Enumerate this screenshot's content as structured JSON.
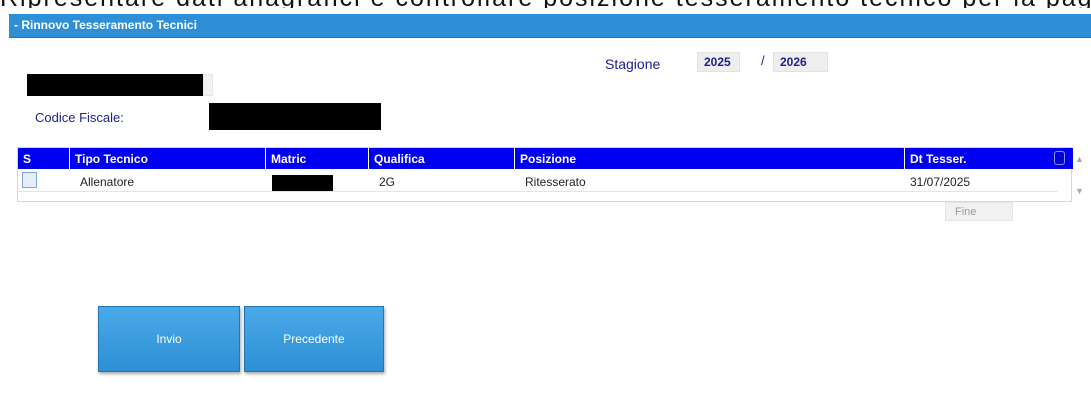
{
  "top_strip_text": "Ripresentare dati anagrafici e controllare posizione tesseramento tecnico per la pagina",
  "window": {
    "title": "- Rinnovo Tesseramento Tecnici"
  },
  "season": {
    "label": "Stagione",
    "from": "2025",
    "separator": "/",
    "to": "2026"
  },
  "person": {
    "codice_fiscale_label": "Codice Fiscale:"
  },
  "table": {
    "columns": [
      "S",
      "Tipo Tecnico",
      "Matric",
      "Qualifica",
      "Posizione",
      "Dt Tesser."
    ],
    "rows": [
      {
        "selected": false,
        "tipo_tecnico": "Allenatore",
        "matric": "",
        "qualifica": "2G",
        "posizione": "Ritesserato",
        "dt_tesser": "31/07/2025"
      }
    ]
  },
  "fine_label": "Fine",
  "buttons": {
    "submit_label": "Invio",
    "previous_label": "Precedente"
  },
  "icons": {
    "scroll_up": "scroll-up-arrow-icon",
    "scroll_down": "scroll-down-arrow-icon"
  },
  "colors": {
    "title_bar": "#2f8fd6",
    "grid_header": "#0000f0",
    "label_text": "#20208f",
    "button": "#2d8fd4"
  }
}
